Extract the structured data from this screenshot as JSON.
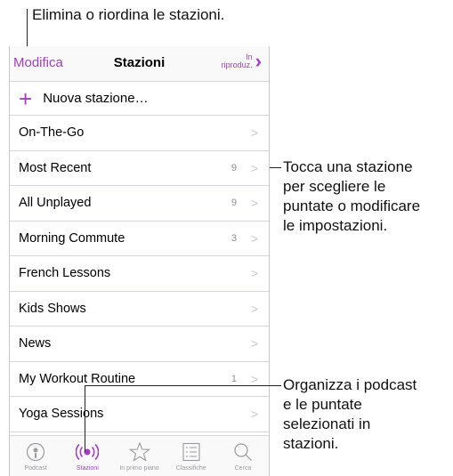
{
  "callouts": {
    "top": "Elimina o riordina le stazioni.",
    "right1": [
      "Tocca una stazione",
      "per scegliere le",
      "puntate o modificare",
      "le impostazioni."
    ],
    "right2": [
      "Organizza i podcast",
      "e le puntate",
      "selezionati in",
      "stazioni."
    ]
  },
  "navbar": {
    "edit_label": "Modifica",
    "title": "Stazioni",
    "now_playing_line1": "In",
    "now_playing_line2": "riproduz.",
    "now_playing_icon": "chevron-right-icon"
  },
  "new_station": {
    "icon": "plus-icon",
    "label": "Nuova stazione…"
  },
  "stations": [
    {
      "name": "On-The-Go",
      "count": ""
    },
    {
      "name": "Most Recent",
      "count": "9"
    },
    {
      "name": "All Unplayed",
      "count": "9"
    },
    {
      "name": "Morning Commute",
      "count": "3"
    },
    {
      "name": "French Lessons",
      "count": ""
    },
    {
      "name": "Kids Shows",
      "count": ""
    },
    {
      "name": "News",
      "count": ""
    },
    {
      "name": "My Workout Routine",
      "count": "1"
    },
    {
      "name": "Yoga Sessions",
      "count": ""
    }
  ],
  "tabbar": {
    "tabs": [
      {
        "label": "Podcast",
        "icon": "podcast-icon"
      },
      {
        "label": "Stazioni",
        "icon": "stations-icon"
      },
      {
        "label": "In primo piano",
        "icon": "star-icon"
      },
      {
        "label": "Classifiche",
        "icon": "list-icon"
      },
      {
        "label": "Cerca",
        "icon": "search-icon"
      }
    ],
    "active": "Stazioni"
  },
  "colors": {
    "accent": "#a33ec0",
    "separator": "#d6d6da",
    "secondary": "#8e8e93"
  }
}
